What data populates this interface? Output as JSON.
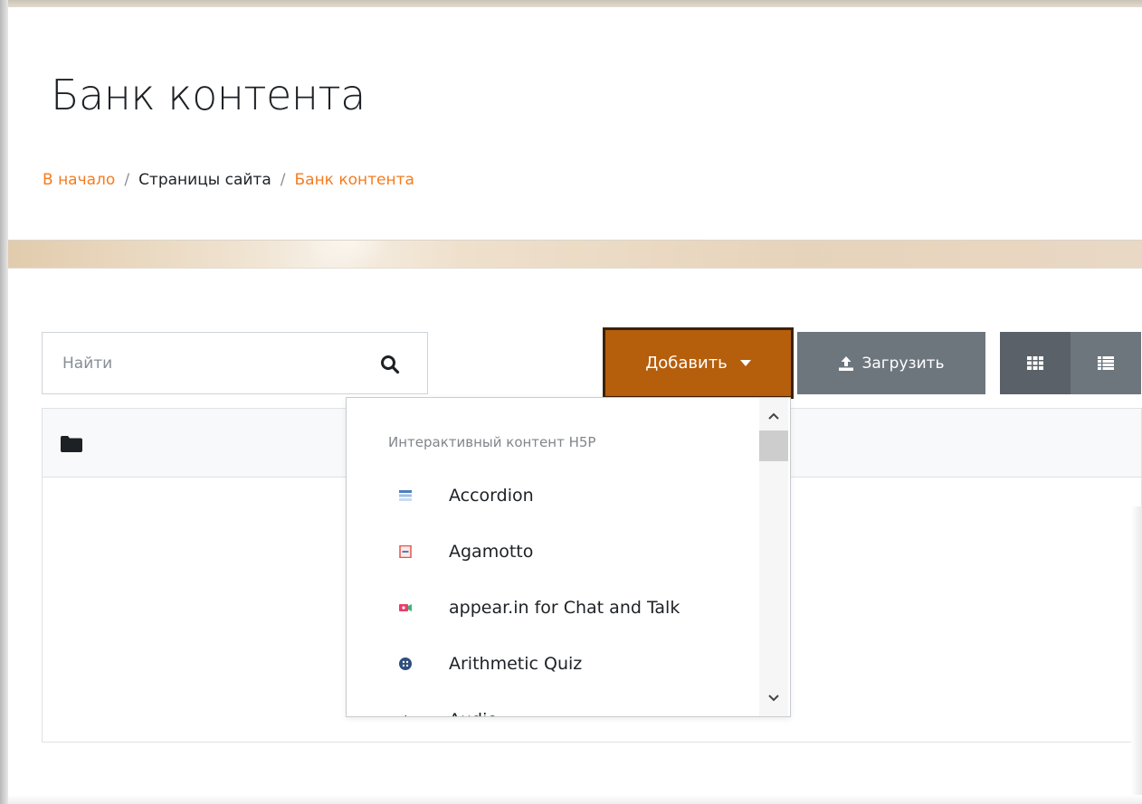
{
  "page": {
    "title": "Банк контента"
  },
  "breadcrumb": {
    "items": [
      {
        "label": "В начало",
        "type": "link"
      },
      {
        "label": "Страницы сайта",
        "type": "text"
      },
      {
        "label": "Банк контента",
        "type": "link"
      }
    ],
    "separator": "/"
  },
  "toolbar": {
    "search": {
      "placeholder": "Найти",
      "value": "",
      "icon": "search-icon"
    },
    "add_button": {
      "label": "Добавить",
      "icon": "caret-down-icon",
      "color": "#b55e0c"
    },
    "upload_button": {
      "label": "Загрузить",
      "icon": "upload-icon",
      "color": "#6d757d"
    },
    "view_grid": {
      "icon": "grid-view-icon",
      "active": true
    },
    "view_list": {
      "icon": "list-view-icon",
      "active": false
    }
  },
  "panel": {
    "header_icon": "folder-icon"
  },
  "dropdown": {
    "header": "Интерактивный контент H5P",
    "items": [
      {
        "label": "Accordion",
        "icon": "accordion-icon",
        "color": "#4a7fc1"
      },
      {
        "label": "Agamotto",
        "icon": "agamotto-icon",
        "color": "#e0574f"
      },
      {
        "label": "appear.in for Chat and Talk",
        "icon": "appear-in-icon",
        "color": "#e83e6c"
      },
      {
        "label": "Arithmetic Quiz",
        "icon": "arithmetic-quiz-icon",
        "color": "#2f4e7d"
      },
      {
        "label": "Audio",
        "icon": "audio-icon",
        "color": "#333333"
      }
    ],
    "scrollbar": {
      "up_icon": "scroll-up-icon",
      "down_icon": "scroll-down-icon"
    }
  },
  "colors": {
    "accent": "#f47c20",
    "add_button": "#b55e0c",
    "secondary_button": "#6d757d"
  }
}
